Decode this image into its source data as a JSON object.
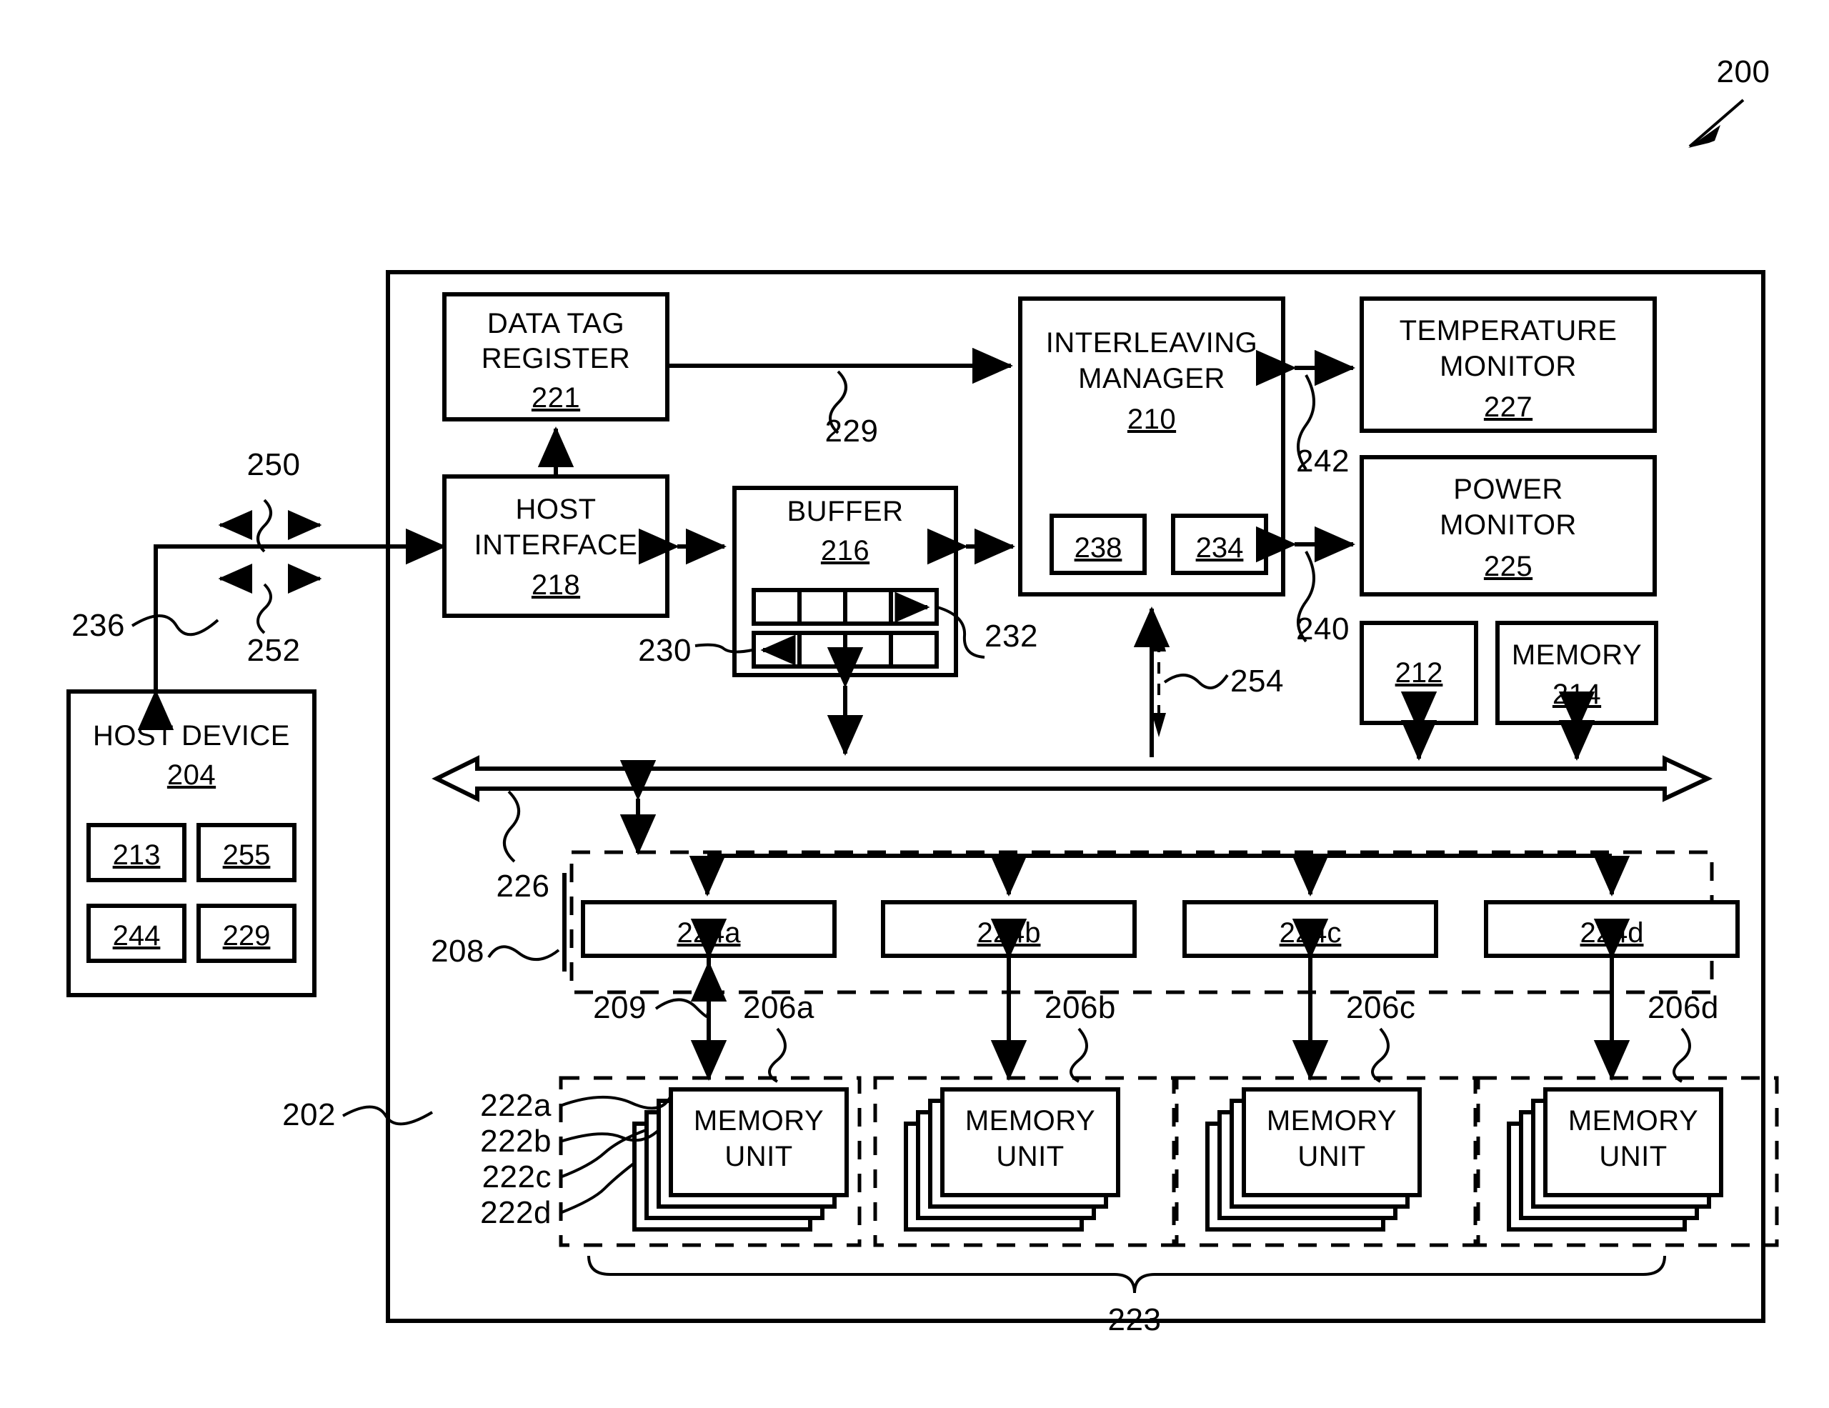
{
  "figure": {
    "number": "200",
    "title_label": "200"
  },
  "outer_device": {
    "ref": "202"
  },
  "host": {
    "title": "HOST DEVICE",
    "ref": "204",
    "sub_blocks": [
      "213",
      "255",
      "244",
      "229"
    ],
    "link_ref_236": "236",
    "link_ref_250": "250",
    "link_ref_252": "252"
  },
  "blocks": {
    "data_tag_register": {
      "line1": "DATA TAG",
      "line2": "REGISTER",
      "ref": "221"
    },
    "host_interface": {
      "line1": "HOST",
      "line2": "INTERFACE",
      "ref": "218"
    },
    "buffer": {
      "line1": "BUFFER",
      "ref": "216",
      "queue_top_ref": "232",
      "queue_bottom_ref": "230",
      "top_arrow": "→",
      "bottom_arrow": "←"
    },
    "interleaving_manager": {
      "line1": "INTERLEAVING",
      "line2": "MANAGER",
      "ref": "210",
      "inner": [
        "238",
        "234"
      ]
    },
    "temperature_monitor": {
      "line1": "TEMPERATURE",
      "line2": "MONITOR",
      "ref": "227"
    },
    "power_monitor": {
      "line1": "POWER",
      "line2": "MONITOR",
      "ref": "225"
    },
    "processor": {
      "ref": "212"
    },
    "memory": {
      "line1": "MEMORY",
      "ref": "214"
    }
  },
  "connections": {
    "tag_to_manager": "229",
    "manager_to_temp": "242",
    "manager_to_power": "240",
    "manager_to_bus": "254",
    "bus": "226",
    "channel_group": "208",
    "die_link": "209",
    "all_units": "223"
  },
  "channels": {
    "labels": [
      "224a",
      "224b",
      "224c",
      "224d"
    ],
    "group_refs": [
      "206a",
      "206b",
      "206c",
      "206d"
    ],
    "die_refs": [
      "222a",
      "222b",
      "222c",
      "222d"
    ],
    "memory_unit_line1": "MEMORY",
    "memory_unit_line2": "UNIT"
  }
}
